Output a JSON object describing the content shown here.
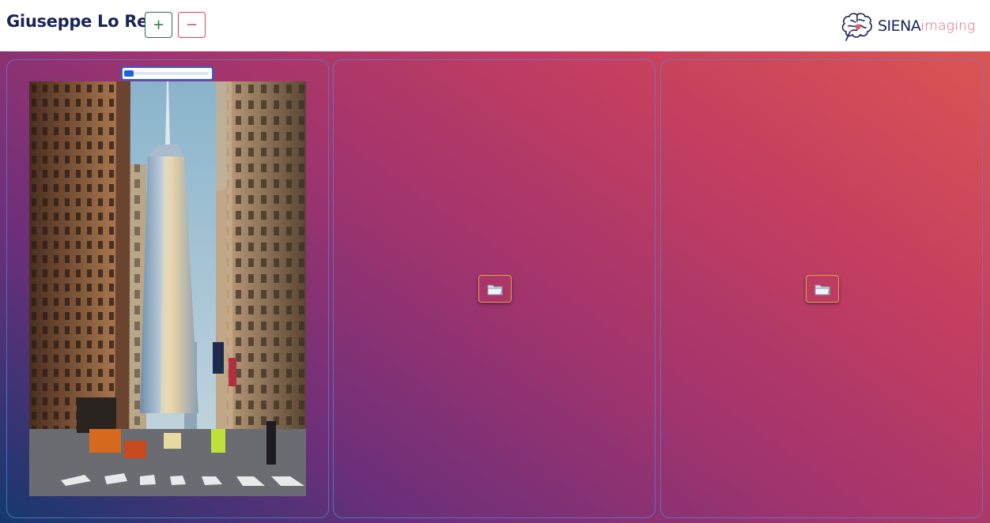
{
  "header": {
    "user_name": "Giuseppe Lo Re",
    "add_label": "+",
    "remove_label": "−",
    "logo": {
      "brand": "SIENA",
      "suffix": "imaging",
      "icon": "brain-icon"
    }
  },
  "panels": [
    {
      "content": "image",
      "image": "city-street-skyscraper-image",
      "slider": {
        "value": 0.05
      }
    },
    {
      "content": "empty",
      "action_icon": "folder-icon"
    },
    {
      "content": "empty",
      "action_icon": "folder-icon"
    }
  ],
  "colors": {
    "title": "#1a2456",
    "add_button": "#2f6e4f",
    "remove_button": "#d9435a",
    "gradient_start": "#15386e",
    "gradient_mid": "#a0346e",
    "gradient_end": "#dc5553",
    "slider_accent": "#2a64d8",
    "folder_border": "#e7a24d",
    "brand_accent": "#e0606b"
  }
}
